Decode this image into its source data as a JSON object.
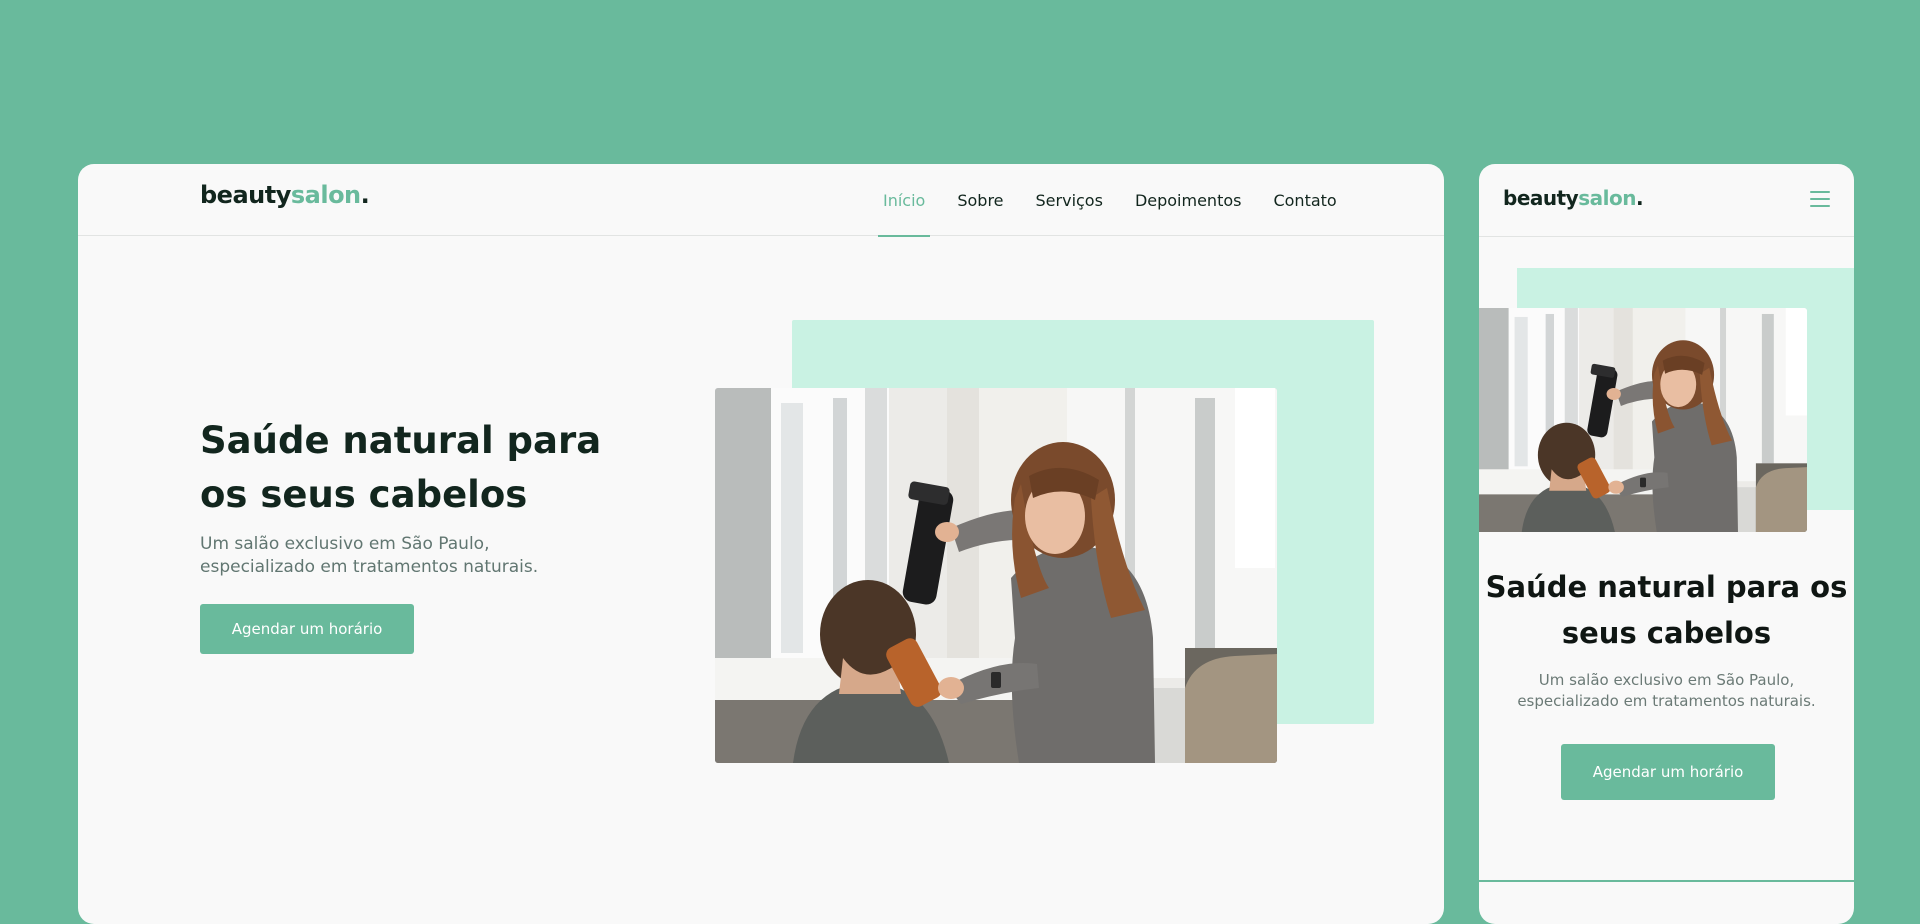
{
  "brand": {
    "part1": "beauty",
    "part2": "salon",
    "part3": "."
  },
  "nav": {
    "items": [
      {
        "label": "Início",
        "active": true
      },
      {
        "label": "Sobre",
        "active": false
      },
      {
        "label": "Serviços",
        "active": false
      },
      {
        "label": "Depoimentos",
        "active": false
      },
      {
        "label": "Contato",
        "active": false
      }
    ]
  },
  "hero": {
    "title": "Saúde natural para os seus cabelos",
    "text": "Um salão exclusivo em São Paulo, especializado em tratamentos naturais.",
    "cta_label": "Agendar um horário",
    "image_name": "hairdresser-blow-drying-client-photo"
  },
  "mobile": {
    "menu_icon": "hamburger-menu-icon"
  },
  "colors": {
    "background": "#69ba9c",
    "accent": "#69ba9c",
    "accent_light": "#c9f2e3",
    "heading": "#12261e",
    "body_text": "#617671",
    "card": "#f9f9f9"
  }
}
